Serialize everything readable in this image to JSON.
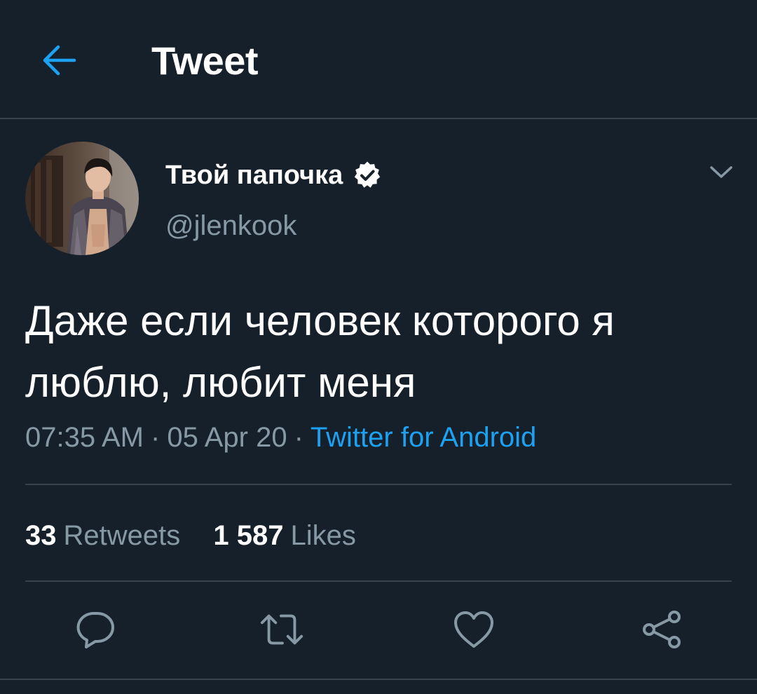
{
  "header": {
    "title": "Tweet",
    "back_icon": "arrow-left-icon",
    "accent_color": "#1da1f2"
  },
  "author": {
    "display_name": "Твой папочка",
    "handle": "@jlenkook",
    "verified": true,
    "verified_icon": "verified-badge-icon"
  },
  "tweet": {
    "text": "Даже если человек которого я люблю, любит меня",
    "time": "07:35 AM",
    "date": "05 Apr 20",
    "separator": "·",
    "source": "Twitter for Android"
  },
  "stats": {
    "retweets_count": "33",
    "retweets_label": "Retweets",
    "likes_count": "1 587",
    "likes_label": "Likes"
  },
  "actions": [
    {
      "name": "reply",
      "icon": "comment-icon"
    },
    {
      "name": "retweet",
      "icon": "retweet-icon"
    },
    {
      "name": "like",
      "icon": "heart-icon"
    },
    {
      "name": "share",
      "icon": "share-icon"
    }
  ],
  "colors": {
    "background": "#15202b",
    "divider": "#38444d",
    "secondary_text": "#8899a6",
    "link": "#1da1f2"
  }
}
